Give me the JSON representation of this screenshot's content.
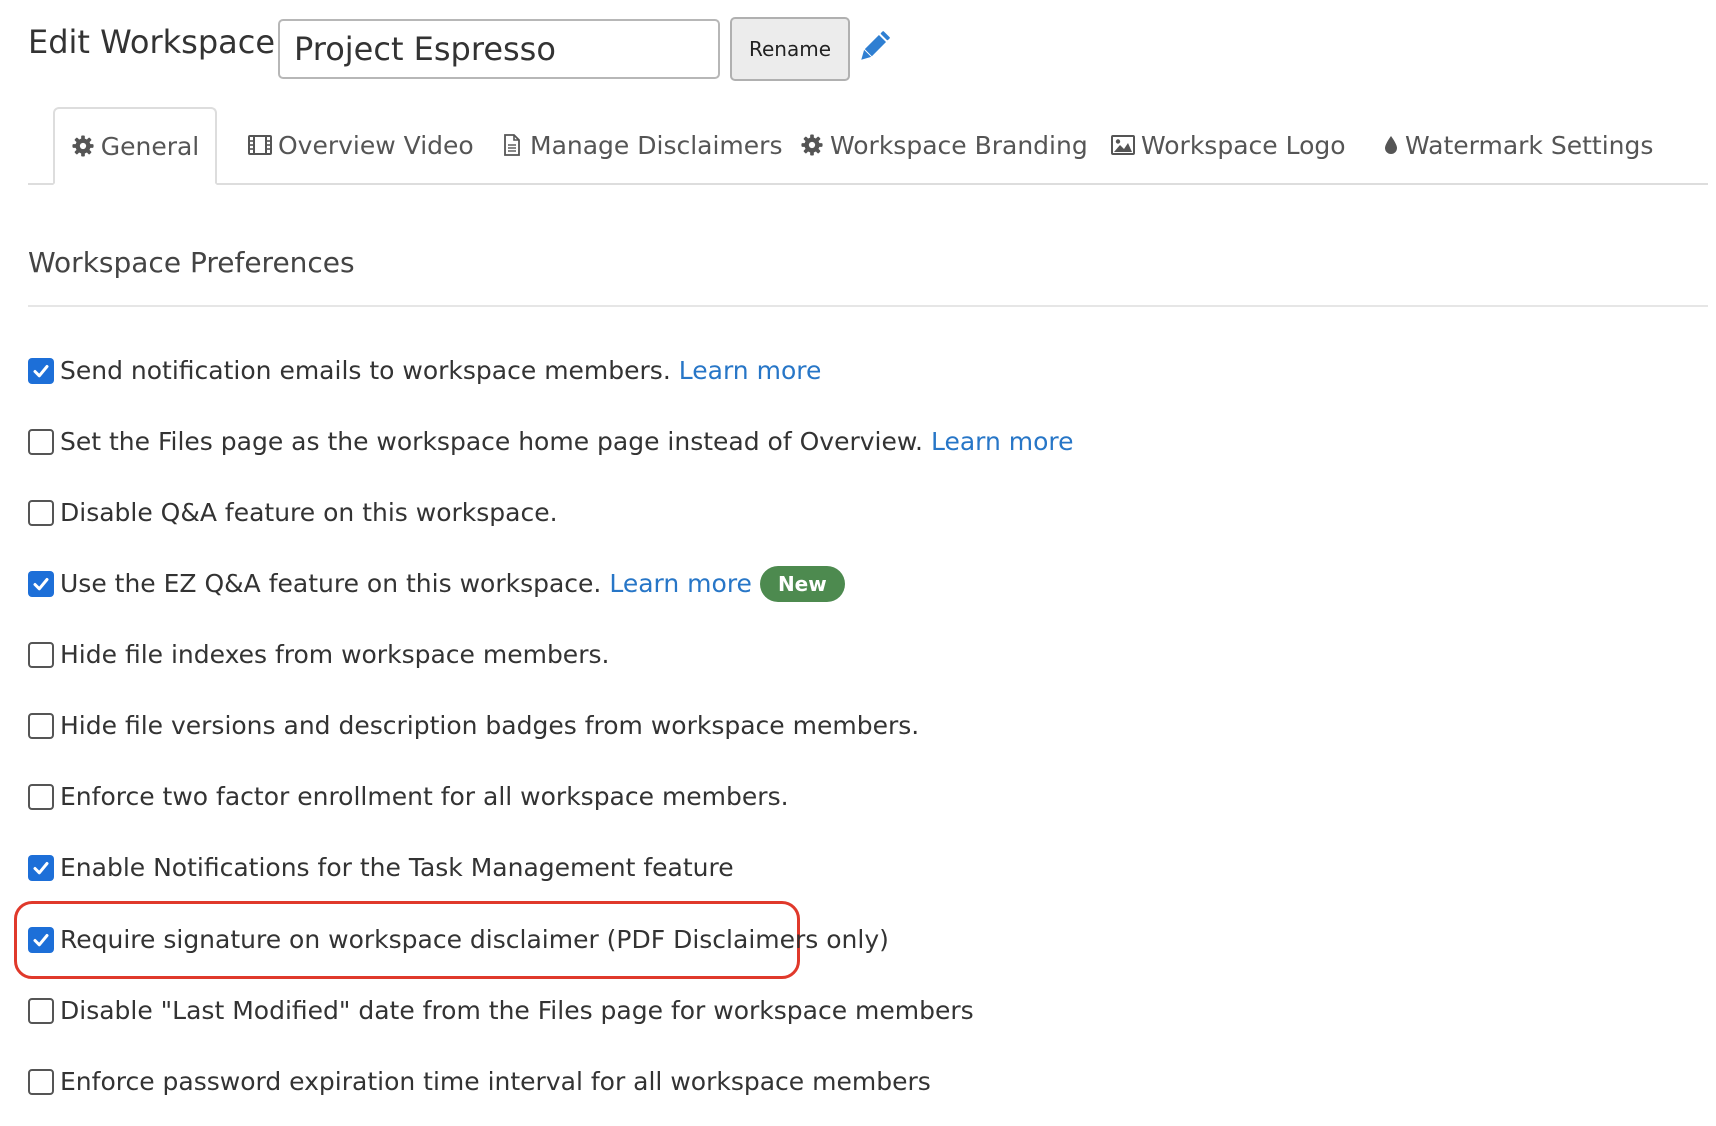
{
  "header": {
    "title": "Edit Workspace -",
    "workspace_name": "Project Espresso",
    "rename_label": "Rename",
    "edit_icon": "pencil-icon"
  },
  "tabs": [
    {
      "label": "General",
      "icon": "gear-icon",
      "active": true
    },
    {
      "label": "Overview Video",
      "icon": "film-icon",
      "active": false
    },
    {
      "label": "Manage Disclaimers",
      "icon": "document-icon",
      "active": false
    },
    {
      "label": "Workspace Branding",
      "icon": "gear-icon",
      "active": false
    },
    {
      "label": "Workspace Logo",
      "icon": "image-icon",
      "active": false
    },
    {
      "label": "Watermark Settings",
      "icon": "droplet-icon",
      "active": false
    }
  ],
  "section": {
    "title": "Workspace Preferences"
  },
  "preferences": [
    {
      "label": "Send notification emails to workspace members.",
      "checked": true,
      "link": "Learn more"
    },
    {
      "label": "Set the Files page as the workspace home page instead of Overview.",
      "checked": false,
      "link": "Learn more"
    },
    {
      "label": "Disable Q&A feature on this workspace.",
      "checked": false
    },
    {
      "label": "Use the EZ Q&A feature on this workspace.",
      "checked": true,
      "link": "Learn more",
      "badge": "New"
    },
    {
      "label": "Hide file indexes from workspace members.",
      "checked": false
    },
    {
      "label": "Hide file versions and description badges from workspace members.",
      "checked": false
    },
    {
      "label": "Enforce two factor enrollment for all workspace members.",
      "checked": false
    },
    {
      "label": "Enable Notifications for the Task Management feature",
      "checked": true
    },
    {
      "label": "Require signature on workspace disclaimer (PDF Disclaimers only)",
      "checked": true,
      "highlighted": true
    },
    {
      "label": "Disable \"Last Modified\" date from the Files page for workspace members",
      "checked": false
    },
    {
      "label": "Enforce password expiration time interval for all workspace members",
      "checked": false
    }
  ],
  "colors": {
    "checkbox_checked": "#1d6fd8",
    "link": "#2776c7",
    "badge": "#4d8a4f",
    "highlight": "#e0392b",
    "text": "#333333"
  }
}
